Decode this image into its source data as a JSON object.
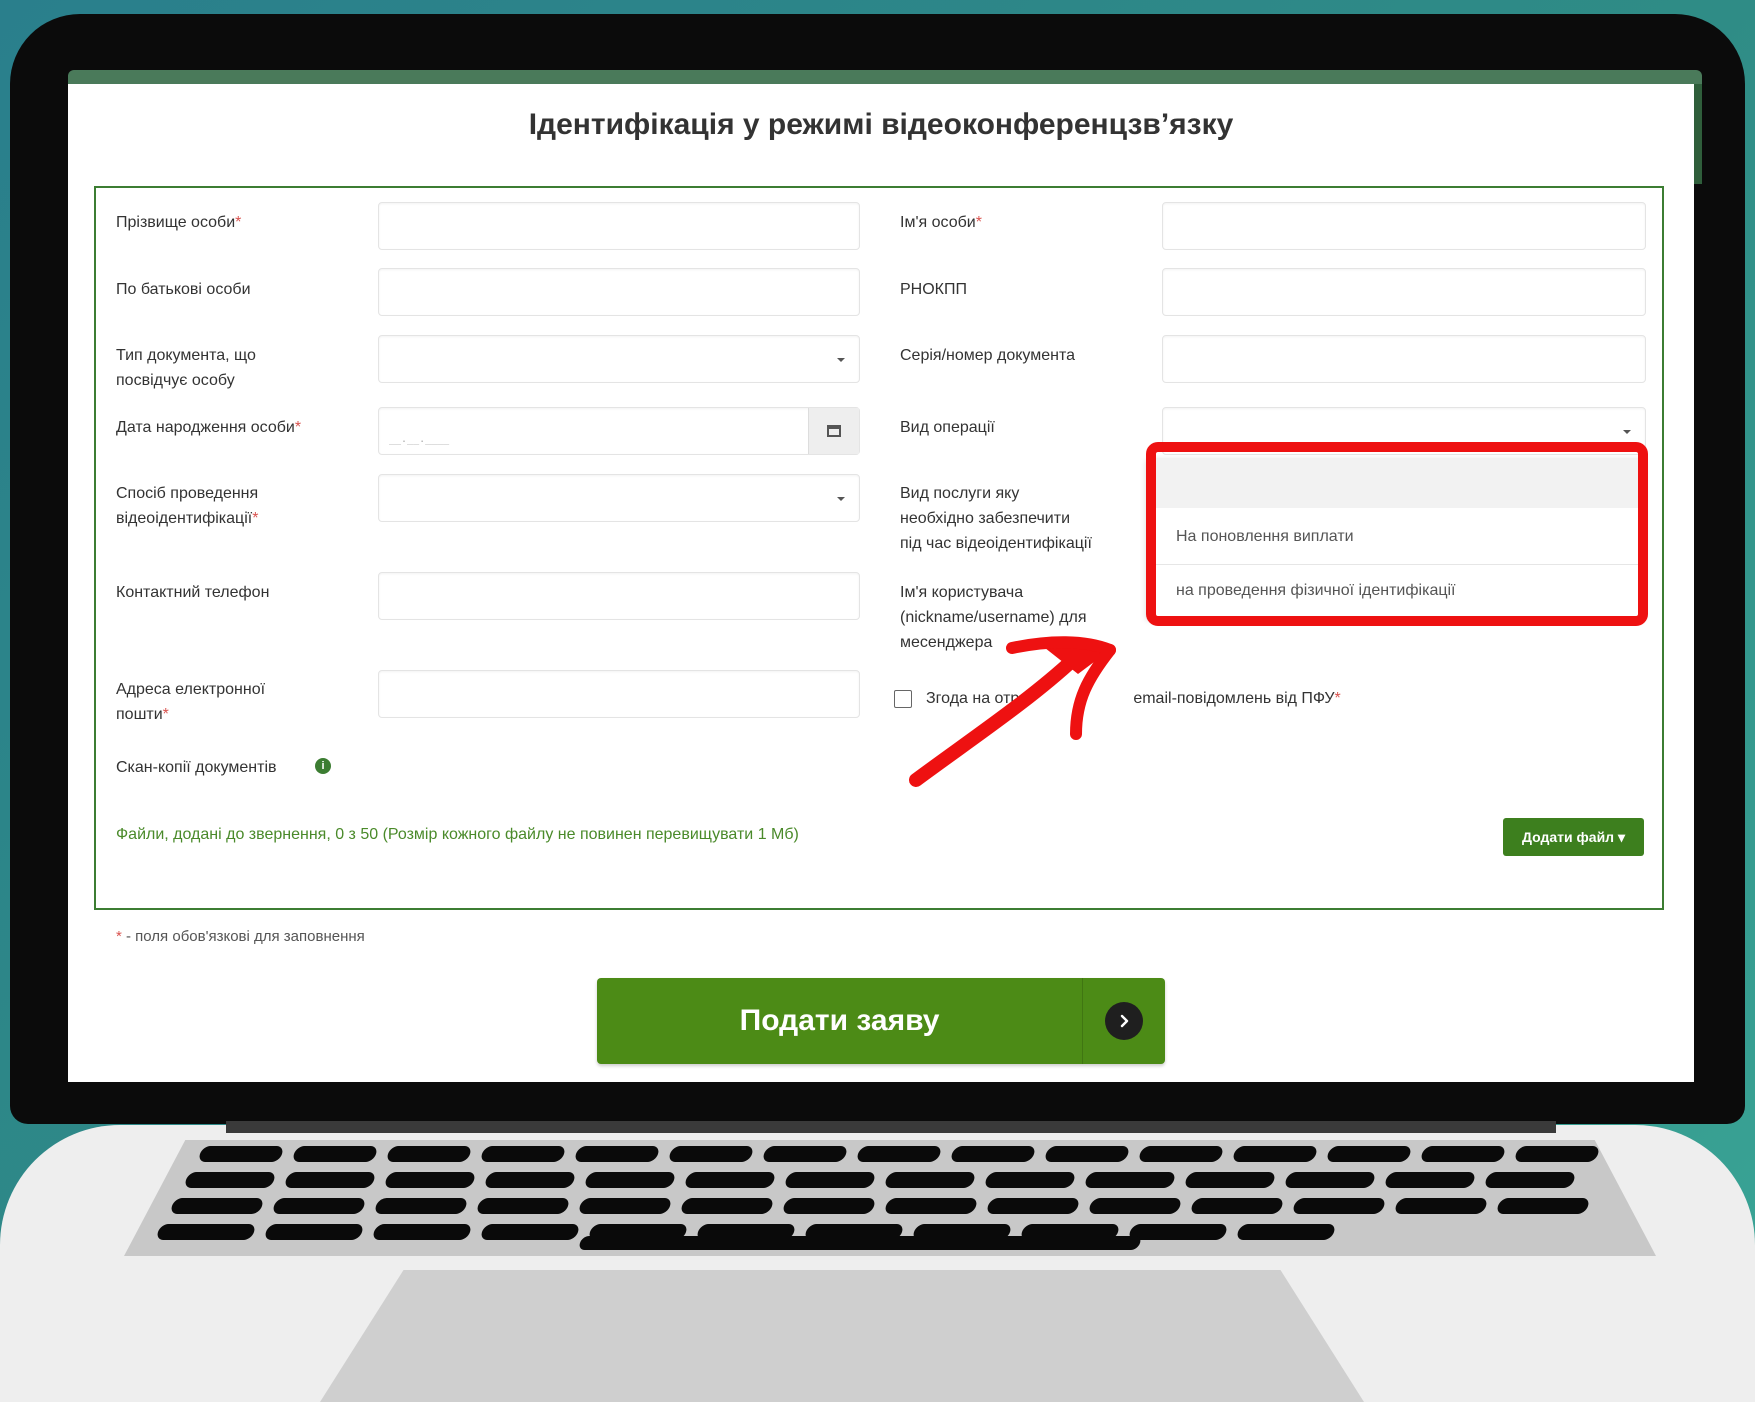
{
  "page": {
    "title": "Ідентифікація у режимі відеоконференцзв’язку"
  },
  "form": {
    "fields": {
      "surname": {
        "label": "Прізвище особи",
        "required": "*",
        "value": ""
      },
      "first_name": {
        "label": "Ім'я особи",
        "required": "*",
        "value": ""
      },
      "patronymic": {
        "label": "По батькові особи",
        "value": ""
      },
      "rnokpp": {
        "label": "РНОКПП",
        "value": ""
      },
      "doc_type": {
        "label_line1": "Тип документа, що",
        "label_line2": "посвідчує особу",
        "value": ""
      },
      "doc_number": {
        "label": "Серія/номер документа",
        "value": ""
      },
      "birth_date": {
        "label": "Дата народження особи",
        "required": "*",
        "mask": "__.__.____"
      },
      "operation_type": {
        "label": "Вид операції",
        "value": ""
      },
      "video_method": {
        "label_line1": "Спосіб проведення",
        "label_line2": "відеоідентифікації",
        "required": "*",
        "value": ""
      },
      "service_type": {
        "label_line1": "Вид послуги яку",
        "label_line2": "необхідно забезпечити",
        "label_line3": "під час відеоідентифікації"
      },
      "phone": {
        "label": "Контактний телефон",
        "value": ""
      },
      "messenger_username": {
        "label_line1": "Ім'я користувача",
        "label_line2": "(nickname/username) для",
        "label_line3": "месенджера"
      },
      "email": {
        "label_line1": "Адреса електронної",
        "label_line2": "пошти",
        "required": "*",
        "value": ""
      }
    },
    "operation_dropdown_options": [
      "На поновлення виплати",
      "на проведення фізичної ідентифікації"
    ],
    "consent": {
      "label_start": "Згода на отр",
      "label_end": "email-повідомлень від ПФУ",
      "required": "*",
      "checked": false
    },
    "scans_label": "Скан-копії документів",
    "files_note": "Файли, додані до звернення, 0 з 50 (Розмір кожного файлу не повинен перевищувати 1 Мб)",
    "add_file_label": "Додати файл ▾",
    "required_note_star": "*",
    "required_note": " - поля обов'язкові для заповнення",
    "submit_label": "Подати заяву"
  },
  "icons": {
    "calendar": "calendar-icon",
    "info": "info-icon",
    "submit_arrow": "chevron-right-icon"
  },
  "colors": {
    "accent_green": "#4c8b16",
    "border_green": "#3c7d32",
    "annotation_red": "#ee1111",
    "required_red": "#d9534f"
  }
}
